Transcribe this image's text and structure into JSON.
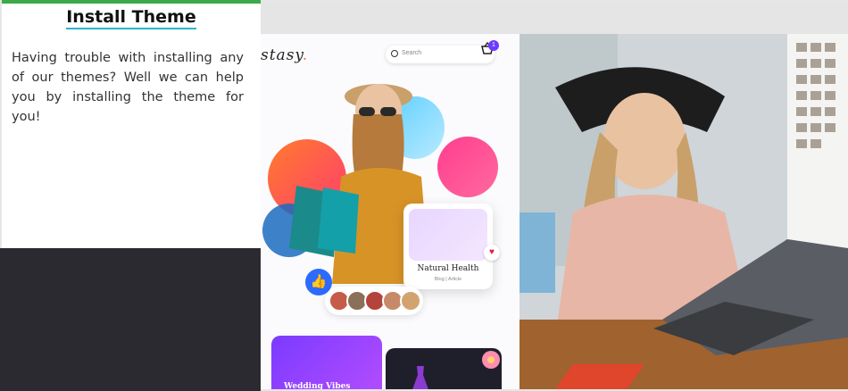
{
  "card": {
    "title": "Install Theme",
    "text": "Having trouble with installing any of our themes? Well we can help you by installing the theme for you!"
  },
  "shop": {
    "logo": "stasy",
    "search_placeholder": "Search",
    "cart_count": "1",
    "feature_title": "Natural Health",
    "feature_sub": "Blog | Article",
    "promo_title": "Wedding Vibes",
    "like_icon": "thumbs-up-icon",
    "heart_icon": "heart-icon"
  },
  "colors": {
    "accent_bar": "#3aaa4a",
    "title_underline": "#2bb5c9",
    "purple": "#6b3bff"
  }
}
